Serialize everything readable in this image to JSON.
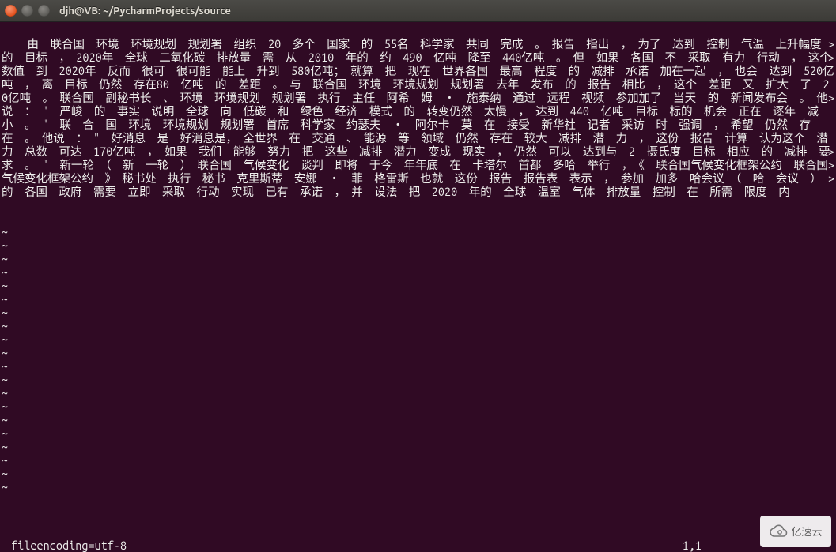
{
  "window": {
    "title": "djh@VB: ~/PycharmProjects/source"
  },
  "editor": {
    "content": "由　联合国　环境　环境规划　规划署　组织　20　多个　国家　的　55名　科学家　共同　完成　。　报告　指出　，　为了　达到　控制　气温　上升幅度　的　目标　，　2020年　全球　二氧化碳　排放量　需　从　2010　年的　约　490　亿吨　降至　440亿吨　。　但　如果　各国　不　采取　有力　行动　，　这个　数值　到　2020年　反而　很可　很可能　能上　升到　580亿吨；　就算　把　现在　世界各国　最高　程度　的　减排　承诺　加在一起　，　也会　达到　520亿吨　，　离　目标　仍然　存在80　亿吨　的　差距　。　与　联合国　环境　环境规划　规划署　去年　发布　的　报告　相比　，　这个　差距　又　扩大　了　20亿吨　。　联合国　副秘书长　、　环境　环境规划　规划署　执行　主任　阿希　姆　・　施泰纳　通过　远程　视频　参加加了　当天　的　新闻发布会　。　他说　：　\"　严峻　的　事实　说明　全球　向　低碳　和　绿色　经济　模式　的　转变仍然　太慢　，　达到　440　亿吨　目标　标的　机会　正在　逐年　减小　。　\"　联　合　国　环境　环境规划　规划署　首席　科学家　约瑟夫　・　阿尔卡　莫　在　接受　新华社　记者　采访　时　强调　，　希望　仍然　存在　。　他说　：　\"　好消息　是　好消息是，　全世界　在　交通　、　能源　等　领域　仍然　存在　较大　减排　潜　力　，　这份　报告　计算　认为这个　潜力　总数　可达　170亿吨　，　如果　我们　能够　努力　把　这些　减排　潜力　变成　现实　，　仍然　可以　达到与　2　摄氏度　目标　相应　的　减排　要求　。　\"　新一轮　（　新　一轮　）　联合国　气候变化　谈判　即将　于今　年年底　在　卡塔尔　首都　多哈　举行　，　《　联合国气候变化框架公约　联合国气候变化框架公约　》　秘书处　执行　秘书　克里斯蒂　安娜　・　菲　格雷斯　也就　这份　报告　报告表　表示　，　参加　加多　哈会议　（　哈　会议　）　的　各国　政府　需要　立即　采取　行动　实现　已有　承诺　，　并　设法　把　2020　年的　全球　温室　气体　排放量　控制　在　所需　限度　内",
    "tilde": "~",
    "tilde_count": 20,
    "wrap_marker": ">",
    "wrap_rows": [
      1,
      2,
      5,
      9,
      10,
      11
    ]
  },
  "status": {
    "left": "fileencoding=utf-8",
    "position": "1,1"
  },
  "badge": {
    "cloud_icon": "cloud-icon",
    "text": "亿速云"
  }
}
